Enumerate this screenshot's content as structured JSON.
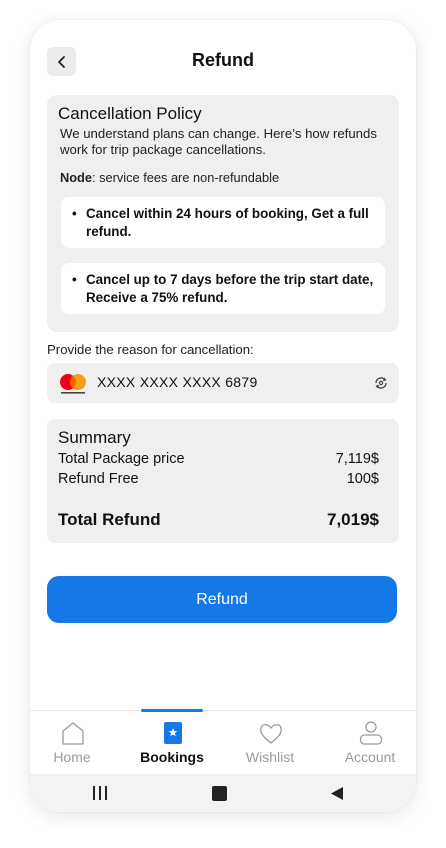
{
  "header": {
    "title": "Refund",
    "back_icon": "chevron-left-icon"
  },
  "policy": {
    "heading": "Cancellation Policy",
    "description": "We understand plans can change. Here’s how refunds work for trip package cancellations.",
    "note_label": "Node",
    "note_text": ": service fees are non-refundable",
    "rules": [
      "Cancel within 24 hours of booking, Get a full refund.",
      "Cancel up to 7 days before the trip start date, Receive a 75% refund."
    ]
  },
  "reason": {
    "label": "Provide the reason for cancellation:"
  },
  "card": {
    "brand": "mastercard",
    "number": "XXXX XXXX XXXX 6879",
    "action_icon": "refresh-icon"
  },
  "summary": {
    "heading": "Summary",
    "package_label": "Total Package price",
    "package_value": "7,119$",
    "fee_label": "Refund Free",
    "fee_value": "100$",
    "total_label": "Total Refund",
    "total_value": "7,019$"
  },
  "refund_button": {
    "label": "Refund"
  },
  "tabs": [
    {
      "label": "Home",
      "icon": "home-icon"
    },
    {
      "label": "Bookings",
      "icon": "bookings-icon"
    },
    {
      "label": "Wishlist",
      "icon": "heart-icon"
    },
    {
      "label": "Account",
      "icon": "user-icon"
    }
  ],
  "colors": {
    "accent": "#1479e6",
    "panel": "#efefef",
    "inactive": "#9a9a9a"
  }
}
